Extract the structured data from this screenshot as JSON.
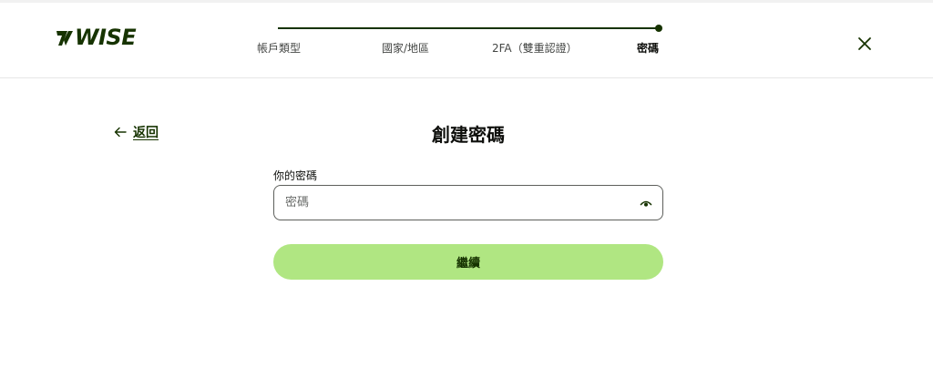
{
  "brand": {
    "logo_text": "WISE",
    "color": "#163300",
    "accent": "#b0e682"
  },
  "stepper": {
    "steps": [
      {
        "label": "帳戶類型"
      },
      {
        "label": "國家/地區"
      },
      {
        "label": "2FA（雙重認證）"
      },
      {
        "label": "密碼"
      }
    ],
    "active_step": 4
  },
  "header": {
    "close_icon": "close-icon"
  },
  "nav": {
    "back_label": "返回",
    "back_icon": "arrow-left-icon"
  },
  "form": {
    "title": "創建密碼",
    "password_label": "你的密碼",
    "password_placeholder": "密碼",
    "password_value": "",
    "visibility_icon": "eye-icon",
    "continue_label": "繼續"
  }
}
